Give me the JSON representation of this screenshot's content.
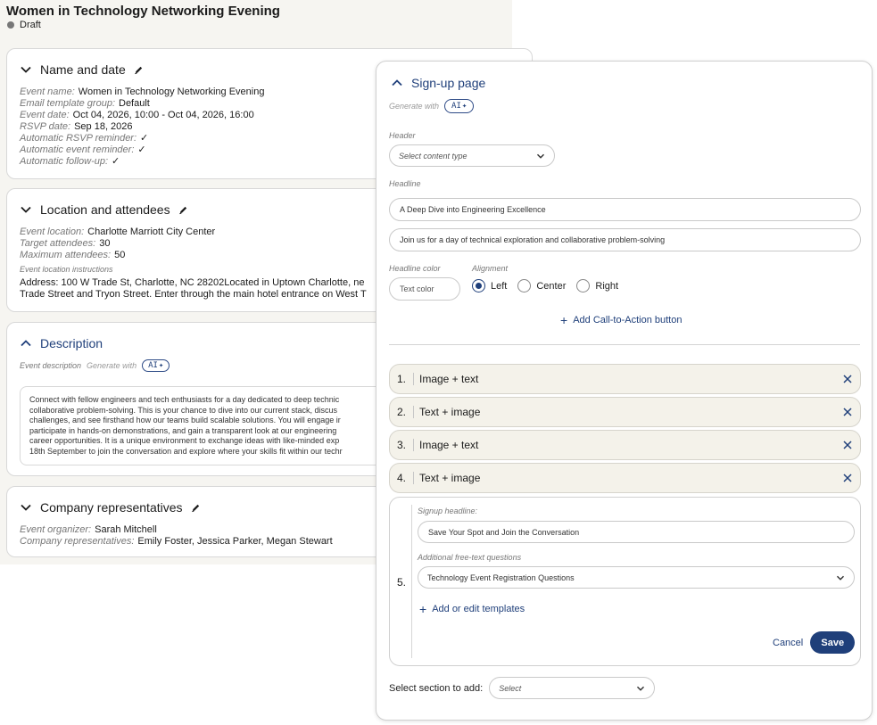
{
  "event": {
    "title": "Women in Technology Networking Evening",
    "status": "Draft"
  },
  "name_and_date": {
    "heading": "Name and date",
    "rows": [
      {
        "label": "Event name:",
        "value": "Women in Technology Networking Evening"
      },
      {
        "label": "Email template group:",
        "value": "Default"
      },
      {
        "label": "Event date:",
        "value": "Oct 04, 2026, 10:00 - Oct 04, 2026, 16:00"
      },
      {
        "label": "RSVP date:",
        "value": "Sep 18, 2026"
      },
      {
        "label": "Automatic RSVP reminder:",
        "value": "✓"
      },
      {
        "label": "Automatic event reminder:",
        "value": "✓"
      },
      {
        "label": "Automatic follow-up:",
        "value": "✓"
      }
    ]
  },
  "location": {
    "heading": "Location and attendees",
    "rows": [
      {
        "label": "Event location:",
        "value": "Charlotte Marriott City Center"
      },
      {
        "label": "Target attendees:",
        "value": "30"
      },
      {
        "label": "Maximum attendees:",
        "value": "50"
      }
    ],
    "instructions_label": "Event location instructions",
    "instructions_lines": [
      "Address: 100 W Trade St, Charlotte, NC 28202Located in Uptown Charlotte, ne",
      "Trade Street and Tryon Street. Enter through the main hotel entrance on West T"
    ]
  },
  "description": {
    "heading": "Description",
    "field_label": "Event description",
    "generate_with": "Generate with",
    "ai_label": "AI",
    "text_lines": [
      "Connect with fellow engineers and tech enthusiasts for a day dedicated to deep technic",
      "collaborative problem-solving. This is your chance to dive into our current stack, discus",
      "challenges, and see firsthand how our teams build scalable solutions. You will engage ir",
      "participate in hands-on demonstrations, and gain a transparent look at our engineering",
      "career opportunities. It is a unique environment to exchange ideas with like-minded exp",
      "18th September to join the conversation and explore where your skills fit within our techr"
    ]
  },
  "company": {
    "heading": "Company representatives",
    "rows": [
      {
        "label": "Event organizer:",
        "value": "Sarah Mitchell"
      },
      {
        "label": "Company representatives:",
        "value": "Emily Foster, Jessica Parker, Megan Stewart"
      }
    ]
  },
  "signup": {
    "heading": "Sign-up page",
    "generate_with": "Generate with",
    "ai_label": "AI",
    "header_label": "Header",
    "header_select_placeholder": "Select content type",
    "headline_label": "Headline",
    "headline_value": "A Deep Dive into Engineering Excellence",
    "subheadline_value": "Join us for a day of technical exploration and collaborative problem-solving",
    "headline_color_label": "Headline color",
    "text_color_placeholder": "Text color",
    "alignment_label": "Alignment",
    "alignment_options": [
      "Left",
      "Center",
      "Right"
    ],
    "alignment_selected": "Left",
    "add_cta": "Add Call-to-Action button",
    "sections": [
      {
        "num": "1.",
        "label": "Image + text"
      },
      {
        "num": "2.",
        "label": "Text + image"
      },
      {
        "num": "3.",
        "label": "Image + text"
      },
      {
        "num": "4.",
        "label": "Text + image"
      }
    ],
    "section5": {
      "num": "5.",
      "signup_headline_label": "Signup headline:",
      "signup_headline_value": "Save Your Spot and Join the Conversation",
      "questions_label": "Additional free-text questions",
      "questions_value": "Technology Event Registration Questions",
      "add_templates": "Add or edit templates",
      "cancel": "Cancel",
      "save": "Save"
    },
    "select_section_label": "Select section to add:",
    "select_section_placeholder": "Select"
  },
  "colors": {
    "accent": "#1f3f7a",
    "section_bg": "#f4f2ea",
    "left_bg": "#f6f5f1"
  }
}
